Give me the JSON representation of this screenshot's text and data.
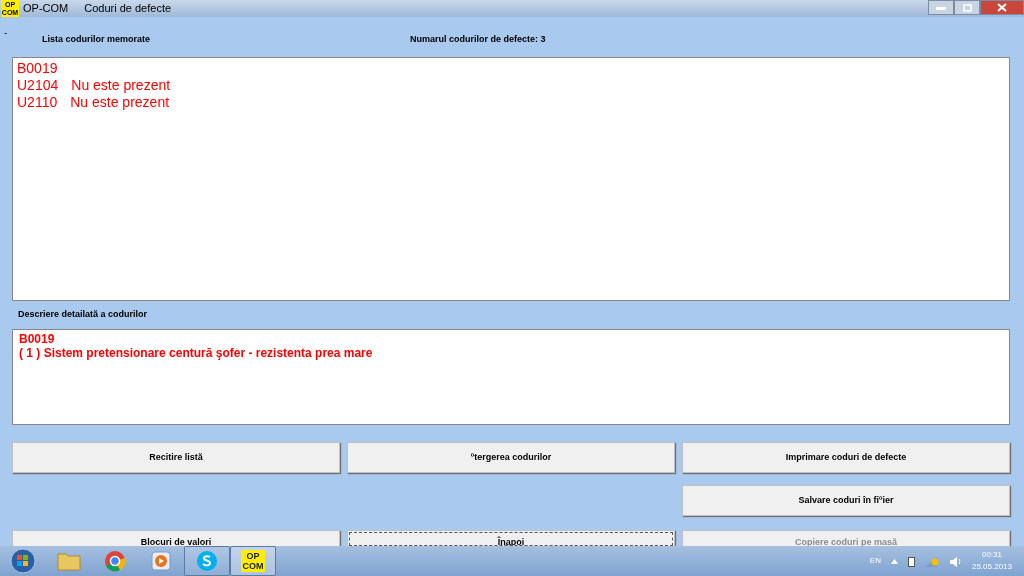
{
  "window": {
    "app_name": "OP-COM",
    "title": "Coduri de defecte",
    "app_icon_lines": [
      "OP",
      "COM"
    ]
  },
  "stray_mark": "-",
  "list_label": "Lista codurilor memorate",
  "count_label": "Numarul codurilor de defecte: 3",
  "codes": [
    {
      "code": "B0019"
    },
    {
      "code": "U2104",
      "status": "Nu este prezent"
    },
    {
      "code": "U2110",
      "status": "Nu este prezent"
    }
  ],
  "description_label": "Descriere detailată a codurilor",
  "description_lines": [
    "B0019",
    "( 1 )  Sistem pretensionare centură şofer - rezistenta prea mare"
  ],
  "button_rows": [
    [
      {
        "label": "Recitire listă",
        "disabled": false,
        "focused": false
      },
      {
        "label": "ºtergerea codurilor",
        "disabled": false,
        "focused": false
      },
      {
        "label": "Imprimare coduri de defecte",
        "disabled": false,
        "focused": false
      }
    ],
    [
      null,
      null,
      {
        "label": "Salvare coduri în fiºier",
        "disabled": false,
        "focused": false
      }
    ],
    [
      {
        "label": "Blocuri de valori",
        "disabled": false,
        "focused": false
      },
      {
        "label": "Înapoi",
        "disabled": false,
        "focused": true
      },
      {
        "label": "Copiere coduri pe masă",
        "disabled": true,
        "focused": false
      }
    ]
  ],
  "taskbar": {
    "apps": [
      {
        "kind": "start"
      },
      {
        "kind": "folder"
      },
      {
        "kind": "browser"
      },
      {
        "kind": "media"
      },
      {
        "kind": "skype",
        "selected": false
      },
      {
        "kind": "opcom",
        "selected": true,
        "lines": [
          "OP",
          "COM"
        ]
      }
    ],
    "language": "EN",
    "time": "00:31",
    "date": "25.05.2013"
  }
}
